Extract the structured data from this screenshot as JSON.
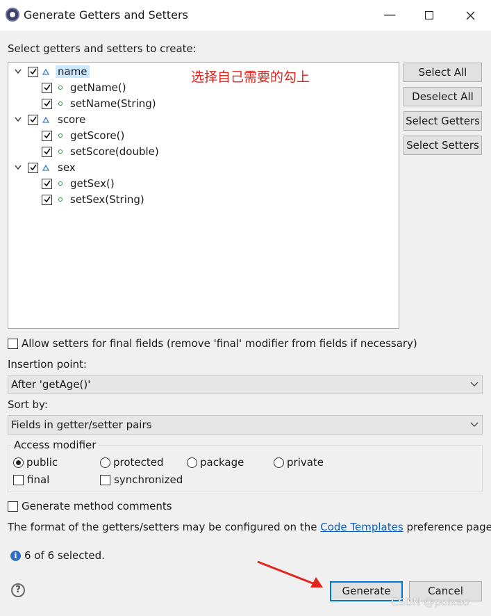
{
  "window": {
    "title": "Generate Getters and Setters",
    "minimize_icon": "minimize-icon",
    "maximize_icon": "maximize-icon",
    "close_icon": "close-icon"
  },
  "tree": {
    "label": "Select getters and setters to create:",
    "annotation": "选择自己需要的勾上",
    "fields": [
      {
        "name": "name",
        "checked": true,
        "methods": [
          {
            "label": "getName()",
            "checked": true
          },
          {
            "label": "setName(String)",
            "checked": true
          }
        ]
      },
      {
        "name": "score",
        "checked": true,
        "methods": [
          {
            "label": "getScore()",
            "checked": true
          },
          {
            "label": "setScore(double)",
            "checked": true
          }
        ]
      },
      {
        "name": "sex",
        "checked": true,
        "methods": [
          {
            "label": "getSex()",
            "checked": true
          },
          {
            "label": "setSex(String)",
            "checked": true
          }
        ]
      }
    ]
  },
  "side_buttons": {
    "select_all": "Select All",
    "deselect_all": "Deselect All",
    "select_getters": "Select Getters",
    "select_setters": "Select Setters"
  },
  "options": {
    "allow_setters_final": "Allow setters for final fields (remove 'final' modifier from fields if necessary)",
    "insertion_point_label": "Insertion point:",
    "insertion_point_value": "After 'getAge()'",
    "sort_by_label": "Sort by:",
    "sort_by_value": "Fields in getter/setter pairs"
  },
  "access_modifier": {
    "title": "Access modifier",
    "public": "public",
    "protected": "protected",
    "package": "package",
    "private": "private",
    "selected": "public",
    "final": "final",
    "synchronized": "synchronized"
  },
  "comments": {
    "generate_comments": "Generate method comments",
    "format_prefix": "The format of the getters/setters may be configured on the",
    "link": "Code Templates",
    "format_suffix": "preference page."
  },
  "status": {
    "selected_text": "6 of 6 selected."
  },
  "buttons": {
    "generate": "Generate",
    "cancel": "Cancel"
  },
  "watermark": "CSDN @poixao",
  "colors": {
    "annotation": "#e0261f",
    "arrow": "#e0261f",
    "link": "#0b5fbf",
    "default_button_border": "#0078d7",
    "selection": "#cce8ff"
  }
}
